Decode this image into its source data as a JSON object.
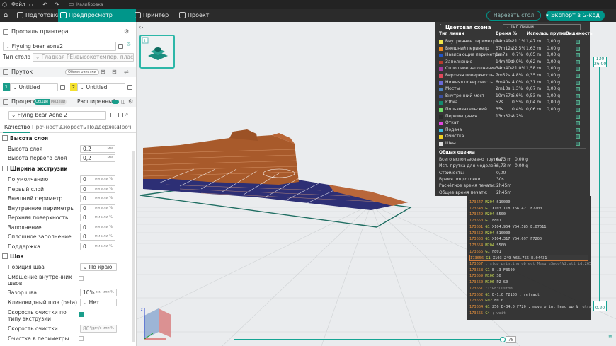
{
  "titlebar": {
    "file_label": "Файл",
    "calibration": "Калибровка"
  },
  "tabs": [
    {
      "label": "Подготовка"
    },
    {
      "label": "Предпросмотр нарезки"
    },
    {
      "label": "Принтер"
    },
    {
      "label": "Проект"
    }
  ],
  "actions": {
    "slice_plate": "Нарезать стол",
    "export_gcode": "Экспорт в G-код"
  },
  "left": {
    "printer_profile_title": "Профиль принтера",
    "printer_name": "Flyuing bear aone2",
    "plate_type_label": "Тип стола",
    "plate_type_value": "Гладкая PEI/высокотемпер. пластина",
    "filament_title": "Пруток",
    "filament_sync_badge": "Обьем очистки",
    "filament1_index": "1",
    "filament1_name": "Untitled",
    "filament2_index": "2",
    "filament2_name": "Untitled",
    "process_title": "Процесс",
    "process_tab_general": "Общие",
    "process_tab_models": "Модели",
    "advanced_label": "Расширенный",
    "process_name": "Flying bear Aone 2",
    "subtabs": [
      "Качество",
      "Прочность",
      "Скорость",
      "Поддержка",
      "Проч"
    ],
    "group_layer_height": "Высота слоя",
    "layer_height_label": "Высота слоя",
    "layer_height_value": "0,2",
    "layer_height_unit": "мм",
    "first_layer_height_label": "Высота первого слоя",
    "first_layer_height_value": "0,2",
    "first_layer_height_unit": "мм",
    "group_line_width": "Ширина экструзии",
    "line_widths": [
      {
        "label": "По умолчанию",
        "value": "0",
        "unit": "мм или %"
      },
      {
        "label": "Первый слой",
        "value": "0",
        "unit": "мм или %"
      },
      {
        "label": "Внешний периметр",
        "value": "0",
        "unit": "мм или %"
      },
      {
        "label": "Внутренние периметры",
        "value": "0",
        "unit": "мм или %"
      },
      {
        "label": "Верхняя поверхность",
        "value": "0",
        "unit": "мм или %"
      },
      {
        "label": "Заполнение",
        "value": "0",
        "unit": "мм или %"
      },
      {
        "label": "Сплошное заполнение",
        "value": "0",
        "unit": "мм или %"
      },
      {
        "label": "Поддержка",
        "value": "0",
        "unit": "мм или %"
      }
    ],
    "group_seam": "Шов",
    "seam_position_label": "Позиция шва",
    "seam_position_value": "По краю",
    "staggered_inner_seams_label": "Смещение внутренних швов",
    "seam_gap_label": "Зазор шва",
    "seam_gap_value": "10%",
    "seam_gap_unit": "мм или %",
    "scarf_seam_label": "Клиновидный шов (beta)",
    "scarf_seam_value": "Нет",
    "wipe_speed_by_type_label": "Скорость очистки по типу экструзии",
    "wipe_speed_label": "Скорость очистки",
    "wipe_speed_value": "80%",
    "wipe_speed_unit": "мм/с или %",
    "wipe_on_loops_label": "Очистка в периметры"
  },
  "legend": {
    "title": "Цветовая схема",
    "scheme_value": "Тип линии",
    "col_type": "Тип линии",
    "col_time": "Время",
    "col_pct": "%",
    "col_usage": "Использ. прутка",
    "col_vis": "Видимость",
    "rows": [
      {
        "name": "Внутренние периметры",
        "time": "34m49s",
        "pct": "21,1%",
        "len": "1,47 m",
        "g": "0,00 g",
        "color": "#f2e74b"
      },
      {
        "name": "Внешний периметр",
        "time": "37m12s",
        "pct": "22,5%",
        "len": "1,63 m",
        "g": "0,00 g",
        "color": "#f08a1e"
      },
      {
        "name": "Нависающие периметры",
        "time": "1m7s",
        "pct": "0,7%",
        "len": "0,05 m",
        "g": "0,00 g",
        "color": "#2155c8"
      },
      {
        "name": "Заполнение",
        "time": "14m49s",
        "pct": "9,0%",
        "len": "0,62 m",
        "g": "0,00 g",
        "color": "#b83a2c"
      },
      {
        "name": "Сплошное заполнение",
        "time": "34m40s",
        "pct": "21,0%",
        "len": "1,58 m",
        "g": "0,00 g",
        "color": "#a33aa0"
      },
      {
        "name": "Верхняя поверхность",
        "time": "7m52s",
        "pct": "4,8%",
        "len": "0,35 m",
        "g": "0,00 g",
        "color": "#e0495a"
      },
      {
        "name": "Нижняя поверхность",
        "time": "6m40s",
        "pct": "4,0%",
        "len": "0,31 m",
        "g": "0,00 g",
        "color": "#6a6ad8"
      },
      {
        "name": "Мосты",
        "time": "2m13s",
        "pct": "1,3%",
        "len": "0,07 m",
        "g": "0,00 g",
        "color": "#4d84c4"
      },
      {
        "name": "Внутренний мост",
        "time": "10m57s",
        "pct": "6,6%",
        "len": "0,53 m",
        "g": "0,00 g",
        "color": "#3a4fa0"
      },
      {
        "name": "Юбка",
        "time": "52s",
        "pct": "0,5%",
        "len": "0,04 m",
        "g": "0,00 g",
        "color": "#138a6f"
      },
      {
        "name": "Пользовательский",
        "time": "35s",
        "pct": "0,4%",
        "len": "0,06 m",
        "g": "0,00 g",
        "color": "#6ee06a"
      },
      {
        "name": "Перемещения",
        "time": "13m32s",
        "pct": "8,2%",
        "len": "",
        "g": "",
        "color": "#2b2b2b"
      },
      {
        "name": "Откат",
        "time": "",
        "pct": "",
        "len": "",
        "g": "",
        "color": "#e246e0"
      },
      {
        "name": "Подача",
        "time": "",
        "pct": "",
        "len": "",
        "g": "",
        "color": "#3ac0e0"
      },
      {
        "name": "Очистка",
        "time": "",
        "pct": "",
        "len": "",
        "g": "",
        "color": "#f2d324"
      },
      {
        "name": "Швы",
        "time": "",
        "pct": "",
        "len": "",
        "g": "",
        "color": "#dddddd"
      }
    ],
    "summary_title": "Общая оценка",
    "summary": [
      {
        "label": "Всего использовано прутка:",
        "v1": "6,73 m",
        "v2": "0,00 g"
      },
      {
        "label": "Исп. прутка для моделей:",
        "v1": "6,73 m",
        "v2": "0,00 g"
      },
      {
        "label": "Стоимость:",
        "v1": "0,00",
        "v2": ""
      },
      {
        "label": "Время подготовки:",
        "v1": "30s",
        "v2": ""
      },
      {
        "label": "Расчётное время печати:",
        "v1": "2h45m",
        "v2": ""
      },
      {
        "label": "Общее время печати:",
        "v1": "2h45m",
        "v2": ""
      }
    ]
  },
  "gcode": [
    {
      "n": "173647",
      "k": "M204",
      "rest": "S10000",
      "hl": false
    },
    {
      "n": "173648",
      "k": "G1",
      "rest": "X103.118 Y66.421 F7200",
      "hl": false
    },
    {
      "n": "173649",
      "k": "M204",
      "rest": "S500",
      "hl": false
    },
    {
      "n": "173650",
      "k": "G1",
      "rest": "F801",
      "hl": false
    },
    {
      "n": "173651",
      "k": "G1",
      "rest": "X104.954 Y64.585 E.07611",
      "hl": false
    },
    {
      "n": "173652",
      "k": "M204",
      "rest": "S10000",
      "hl": false
    },
    {
      "n": "173653",
      "k": "G1",
      "rest": "X104.317 Y64.697 F7200",
      "hl": false
    },
    {
      "n": "173654",
      "k": "M204",
      "rest": "S500",
      "hl": false
    },
    {
      "n": "173655",
      "k": "G1",
      "rest": "F801",
      "hl": false
    },
    {
      "n": "173656",
      "k": "G1",
      "rest": "X103.249 Y65.766 E.04431",
      "hl": true
    },
    {
      "n": "173657",
      "k": "",
      "rest": "; stop printing object MesureSpoolV2.stl id:26564847...",
      "hl": false
    },
    {
      "n": "173658",
      "k": "G1",
      "rest": "E-.3 F3600",
      "hl": false
    },
    {
      "n": "173659",
      "k": "M106",
      "rest": "S0",
      "hl": false
    },
    {
      "n": "173660",
      "k": "M106",
      "rest": "P2 S0",
      "hl": false
    },
    {
      "n": "173661",
      "k": "",
      "rest": ";TYPE:Custom",
      "hl": false
    },
    {
      "n": "173662",
      "k": "G1",
      "rest": "E-1.0 F2100 ; retract",
      "hl": false
    },
    {
      "n": "173663",
      "k": "G92",
      "rest": "E0.0",
      "hl": false
    },
    {
      "n": "173664",
      "k": "G1",
      "rest": "Z56 E-34.0 F720 ; move print head up & retract fi...",
      "hl": false
    },
    {
      "n": "173665",
      "k": "G4",
      "rest": "; wait",
      "hl": false
    }
  ],
  "sliders": {
    "top_layer": "130",
    "top_height": "26.00",
    "bottom_layer": "1",
    "bottom_height": "0.20",
    "move_value": "78"
  }
}
